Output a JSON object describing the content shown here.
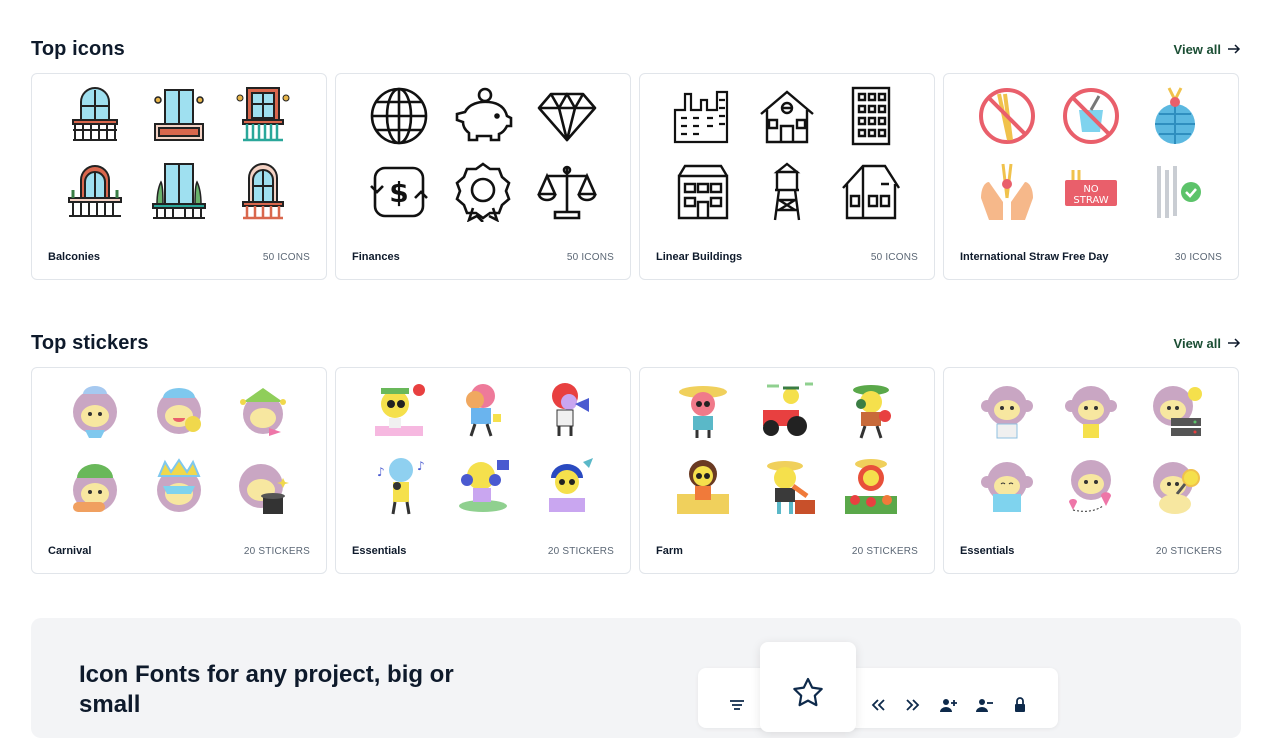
{
  "icons_section": {
    "title": "Top icons",
    "view_all": "View all",
    "cards": [
      {
        "name": "Balconies",
        "count": "50 ICONS",
        "icons": [
          "balcony-arched-window-icon",
          "balcony-double-door-icon",
          "balcony-tall-window-icon",
          "balcony-plants-arch-icon",
          "balcony-glass-door-icon",
          "balcony-french-door-icon"
        ]
      },
      {
        "name": "Finances",
        "count": "50 ICONS",
        "icons": [
          "globe-icon",
          "piggy-bank-icon",
          "diamond-icon",
          "currency-exchange-icon",
          "award-badge-icon",
          "balance-scale-icon"
        ]
      },
      {
        "name": "Linear Buildings",
        "count": "50 ICONS",
        "icons": [
          "factory-icon",
          "house-icon",
          "office-tower-icon",
          "townhouse-icon",
          "water-tower-icon",
          "barn-house-icon"
        ]
      },
      {
        "name": "International Straw Free Day",
        "count": "30 ICONS",
        "icons": [
          "no-straw-sign-icon",
          "no-cup-straw-icon",
          "globe-no-straw-icon",
          "hands-straw-icon",
          "no-straw-label-icon",
          "reusable-straws-icon"
        ]
      }
    ]
  },
  "stickers_section": {
    "title": "Top stickers",
    "view_all": "View all",
    "cards": [
      {
        "name": "Carnival",
        "count": "20 STICKERS",
        "stickers": [
          "carnival-monkey-party-hat-sticker",
          "carnival-monkey-cap-sticker",
          "carnival-monkey-jester-sticker",
          "carnival-monkey-green-hat-sticker",
          "carnival-monkey-mask-sticker",
          "carnival-monkey-top-hat-sticker"
        ]
      },
      {
        "name": "Essentials",
        "count": "20 STICKERS",
        "stickers": [
          "essentials-alert-character-sticker",
          "essentials-reading-character-sticker",
          "essentials-megaphone-character-sticker",
          "essentials-music-character-sticker",
          "essentials-headphones-character-sticker",
          "essentials-laptop-character-sticker"
        ]
      },
      {
        "name": "Farm",
        "count": "20 STICKERS",
        "stickers": [
          "farmer-hat-sticker",
          "farmer-tractor-sticker",
          "farmer-harvest-sticker",
          "farmer-hay-sticker",
          "farmer-vegetables-sticker",
          "farmer-market-sticker"
        ]
      },
      {
        "name": "Essentials",
        "count": "20 STICKERS",
        "stickers": [
          "essentials-monkey-smile-sticker",
          "essentials-monkey-list-sticker",
          "essentials-monkey-server-sticker",
          "essentials-monkey-book-sticker",
          "essentials-monkey-map-sticker",
          "essentials-monkey-magnifier-sticker"
        ]
      }
    ]
  },
  "promo": {
    "title": "Icon Fonts for any project, big or small",
    "toolbar_icons": [
      "menu-lines-icon",
      "star-outline-icon",
      "chevrons-left-icon",
      "chevrons-right-icon",
      "user-add-icon",
      "user-remove-icon",
      "lock-icon"
    ]
  },
  "colors": {
    "accent_green": "#1b4e34",
    "text_dark": "#0e1a2b",
    "muted_text": "#5b6775",
    "card_border": "#e1e5ea",
    "promo_bg": "#f3f4f6"
  }
}
